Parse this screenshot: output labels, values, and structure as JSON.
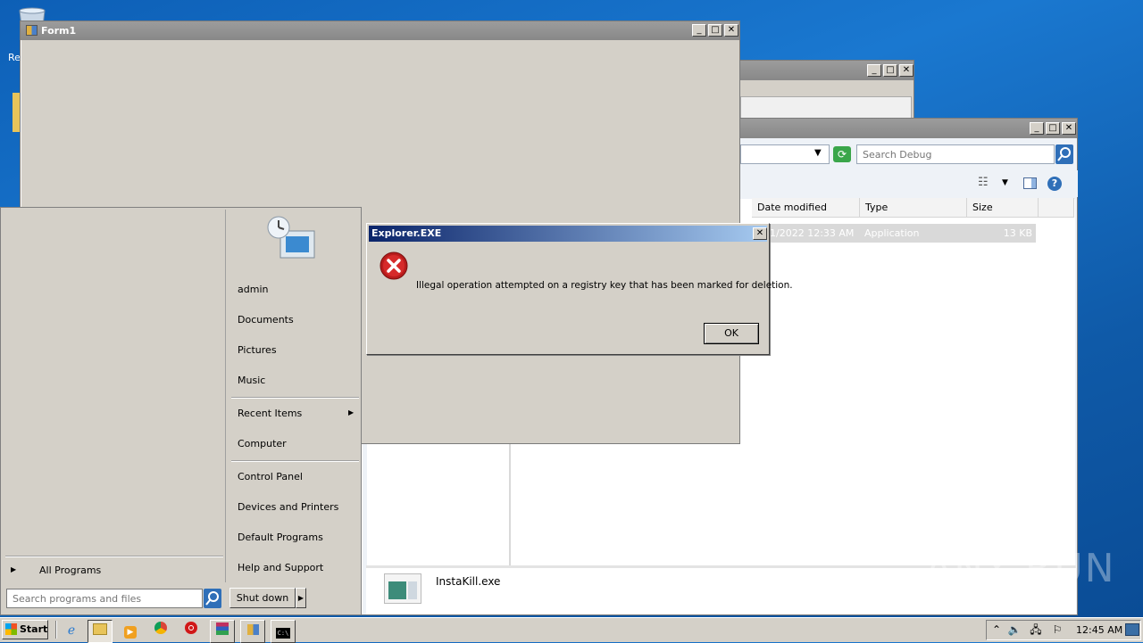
{
  "desktop": {
    "recycle_label": "Re"
  },
  "form1": {
    "title": "Form1"
  },
  "window_controls": {
    "min": "_",
    "max": "□",
    "close": "✕"
  },
  "explorer": {
    "search_placeholder": "Search Debug",
    "columns": [
      "Date modified",
      "Type",
      "Size"
    ],
    "file_row": {
      "date": "1/2022 12:33 AM",
      "type": "Application",
      "size": "13 KB"
    },
    "details_name": "InstaKill.exe"
  },
  "dialog": {
    "title": "Explorer.EXE",
    "message": "Illegal operation attempted on a registry key that has been marked for deletion.",
    "ok_label": "OK",
    "close": "✕"
  },
  "start_menu": {
    "right_items": [
      "admin",
      "Documents",
      "Pictures",
      "Music",
      "Recent Items",
      "Computer",
      "Control Panel",
      "Devices and Printers",
      "Default Programs",
      "Help and Support"
    ],
    "all_programs": "All Programs",
    "search_placeholder": "Search programs and files",
    "shutdown_label": "Shut down"
  },
  "taskbar": {
    "start_label": "Start",
    "clock": "12:45 AM"
  },
  "watermark": "ANY RUN"
}
